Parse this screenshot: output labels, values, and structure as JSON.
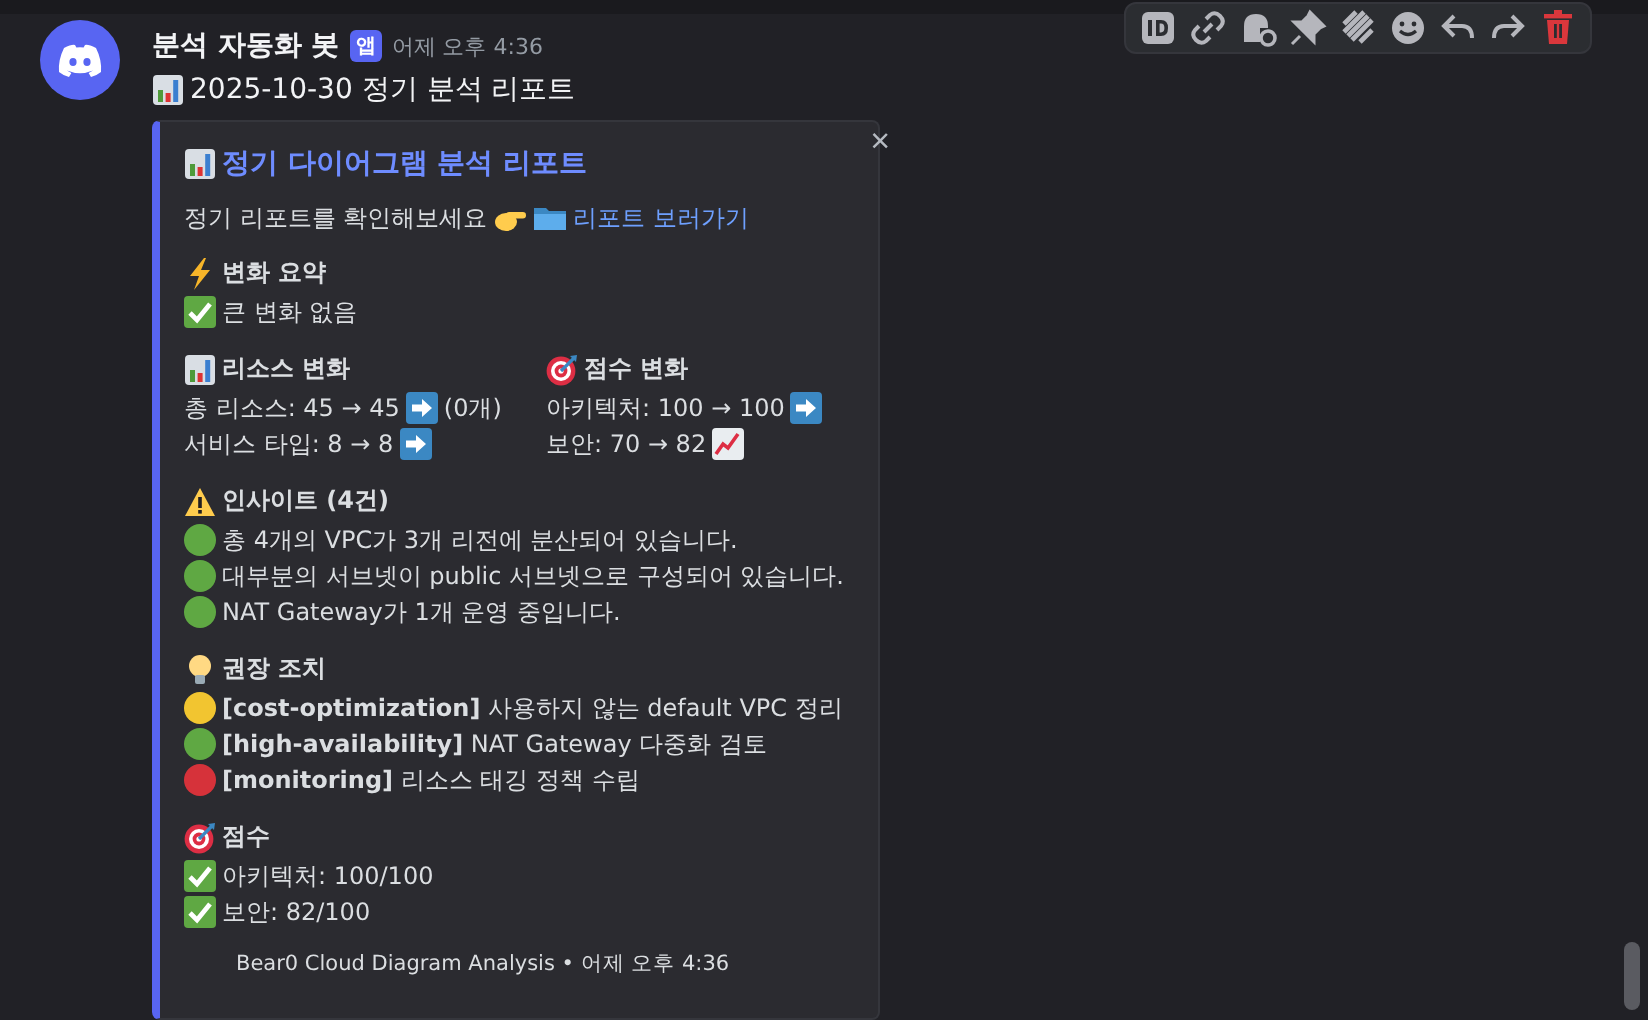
{
  "message": {
    "author": "분석 자동화 봇",
    "badge": "앱",
    "timestamp": "어제 오후 4:36",
    "content": [
      {
        "kind": "chart"
      },
      {
        "text": "2025-10-30 정기 분석 리포트"
      }
    ]
  },
  "embed": {
    "title": [
      {
        "kind": "chart"
      },
      {
        "text": "정기 다이어그램 분석 리포트"
      }
    ],
    "close": "×",
    "description": [
      {
        "text": "정기 리포트를 확인해보세요"
      },
      {
        "kind": "pointer"
      },
      {
        "kind": "folder"
      },
      {
        "link": "리포트 보러가기"
      }
    ],
    "sections": [
      {
        "kind": "block",
        "heading": [
          {
            "kind": "bolt"
          },
          {
            "text": "변화 요약"
          }
        ],
        "lines": [
          [
            {
              "kind": "check"
            },
            {
              "text": "큰 변화 없음"
            }
          ]
        ]
      },
      {
        "kind": "fields",
        "columns": [
          {
            "heading": [
              {
                "kind": "chart"
              },
              {
                "text": "리소스 변화"
              }
            ],
            "lines": [
              [
                {
                  "text": "총 리소스: 45 → 45"
                },
                {
                  "kind": "arrow"
                },
                {
                  "text": "(0개)"
                }
              ],
              [
                {
                  "text": "서비스 타입: 8 → 8"
                },
                {
                  "kind": "arrow"
                }
              ]
            ]
          },
          {
            "heading": [
              {
                "kind": "target"
              },
              {
                "text": "점수 변화"
              }
            ],
            "lines": [
              [
                {
                  "text": "아키텍처: 100 → 100"
                },
                {
                  "kind": "arrow"
                }
              ],
              [
                {
                  "text": "보안: 70 → 82"
                },
                {
                  "kind": "trend"
                }
              ]
            ]
          }
        ]
      },
      {
        "kind": "block",
        "heading": [
          {
            "kind": "warning"
          },
          {
            "text": "인사이트 (4건)"
          }
        ],
        "lines": [
          [
            {
              "kind": "dot",
              "color": "#5fa843"
            },
            {
              "text": "총 4개의 VPC가 3개 리전에 분산되어 있습니다."
            }
          ],
          [
            {
              "kind": "dot",
              "color": "#5fa843"
            },
            {
              "text": "대부분의 서브넷이 public 서브넷으로 구성되어 있습니다."
            }
          ],
          [
            {
              "kind": "dot",
              "color": "#5fa843"
            },
            {
              "text": "NAT Gateway가 1개 운영 중입니다."
            }
          ]
        ]
      },
      {
        "kind": "block",
        "heading": [
          {
            "kind": "bulb"
          },
          {
            "text": "권장 조치"
          }
        ],
        "lines": [
          [
            {
              "kind": "dot",
              "color": "#f2c530"
            },
            {
              "text": "**[cost-optimization]** 사용하지 않는 default VPC 정리"
            }
          ],
          [
            {
              "kind": "dot",
              "color": "#5fa843"
            },
            {
              "text": "**[high-availability]** NAT Gateway 다중화 검토"
            }
          ],
          [
            {
              "kind": "dot",
              "color": "#d6323a"
            },
            {
              "text": "**[monitoring]** 리소스 태깅 정책 수립"
            }
          ]
        ]
      },
      {
        "kind": "block",
        "heading": [
          {
            "kind": "target"
          },
          {
            "text": "점수"
          }
        ],
        "lines": [
          [
            {
              "kind": "check"
            },
            {
              "text": "아키텍처: 100/100"
            }
          ],
          [
            {
              "kind": "check"
            },
            {
              "text": "보안: 82/100"
            }
          ]
        ]
      }
    ],
    "footer": "Bear0 Cloud Diagram Analysis • 어제 오후 4:36"
  }
}
